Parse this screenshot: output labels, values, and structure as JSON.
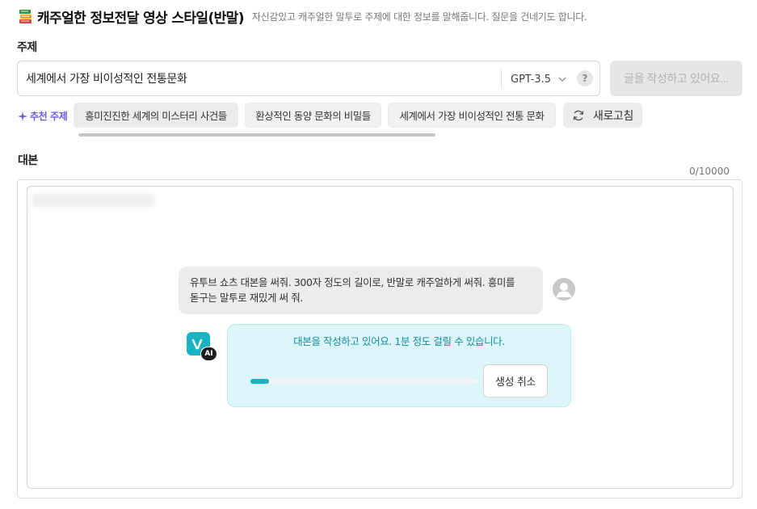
{
  "header": {
    "title": "캐주얼한 정보전달 영상 스타일(반말)",
    "subtitle": "자신감있고 캐주얼한 말투로 주제에 대한 정보를 말해줍니다. 질문을 건네기도 합니다."
  },
  "topic": {
    "label": "주제",
    "value": "세계에서 가장 비이성적인 전통문화",
    "model": "GPT-3.5",
    "help": "?",
    "generate_button": "글을 작성하고 있어요..."
  },
  "recommend": {
    "label": "추천 주제",
    "chips": [
      "흥미진진한 세계의 미스터리 사건들",
      "환상적인 동양 문화의 비밀들",
      "세계에서 가장 비이성적인 전통 문화"
    ],
    "refresh": "새로고침"
  },
  "script": {
    "label": "대본",
    "count": "0/10000"
  },
  "chat": {
    "user_line1": "유투브 쇼츠 대본을 써줘. 300자 정도의 길이로, 반말로 캐주얼하게 써줘. 흥미를",
    "user_line2": "돋구는 말투로 재밌게 써 줘.",
    "ai_badge": "AI",
    "ai_status": "대본을 작성하고 있어요. 1분 정도 걸릴 수 있습니다.",
    "progress_fraction": 0.08,
    "cancel": "생성 취소"
  },
  "colors": {
    "accent": "#1ab3c4",
    "recommend_label": "#6e5bd6"
  },
  "icons": [
    "books-icon",
    "chevron-down-icon",
    "help-icon",
    "sparkle-icon",
    "refresh-icon",
    "user-avatar-icon",
    "vrew-logo-icon"
  ]
}
